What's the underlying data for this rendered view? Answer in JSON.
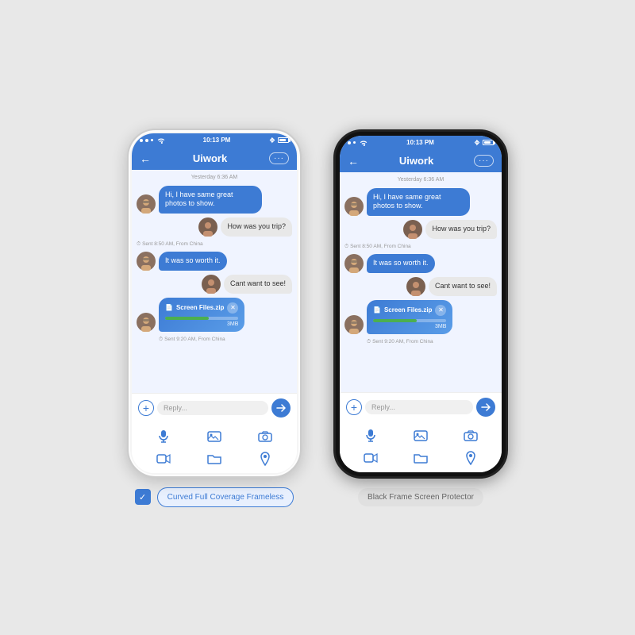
{
  "page": {
    "background": "#e8e8e8"
  },
  "left_phone": {
    "status_bar": {
      "time": "10:13 PM",
      "signals": "●●● ≈ ψ",
      "battery": "▐"
    },
    "header": {
      "back_label": "←",
      "title": "Uiwork",
      "more_label": "···"
    },
    "label": {
      "checkbox_check": "✓",
      "text": "Curved Full Coverage Frameless"
    }
  },
  "right_phone": {
    "status_bar": {
      "time": "10:13 PM"
    },
    "header": {
      "back_label": "←",
      "title": "Uiwork",
      "more_label": "···"
    },
    "label": {
      "text": "Black Frame Screen Protector"
    }
  },
  "chat": {
    "timestamp": "Yesterday 6:36 AM",
    "messages": [
      {
        "id": "msg1",
        "side": "left",
        "text": "Hi, I have same great photos to show.",
        "type": "bubble-blue"
      },
      {
        "id": "msg2",
        "side": "right",
        "text": "How was you trip?",
        "type": "bubble-gray",
        "meta": "Sent 8:50 AM, From China"
      },
      {
        "id": "msg3",
        "side": "left",
        "text": "It was so worth it.",
        "type": "bubble-blue"
      },
      {
        "id": "msg4",
        "side": "right",
        "text": "Cant want to see!",
        "type": "bubble-gray"
      },
      {
        "id": "msg5",
        "side": "left",
        "text": "Screen Files.zip",
        "type": "file",
        "size": "3MB",
        "meta": "Sent 9:20 AM, From China"
      }
    ],
    "input_placeholder": "Reply...",
    "icons": {
      "microphone": "🎤",
      "image": "🖼",
      "camera": "📷",
      "video": "📹",
      "folder": "📁",
      "location": "📍"
    }
  }
}
